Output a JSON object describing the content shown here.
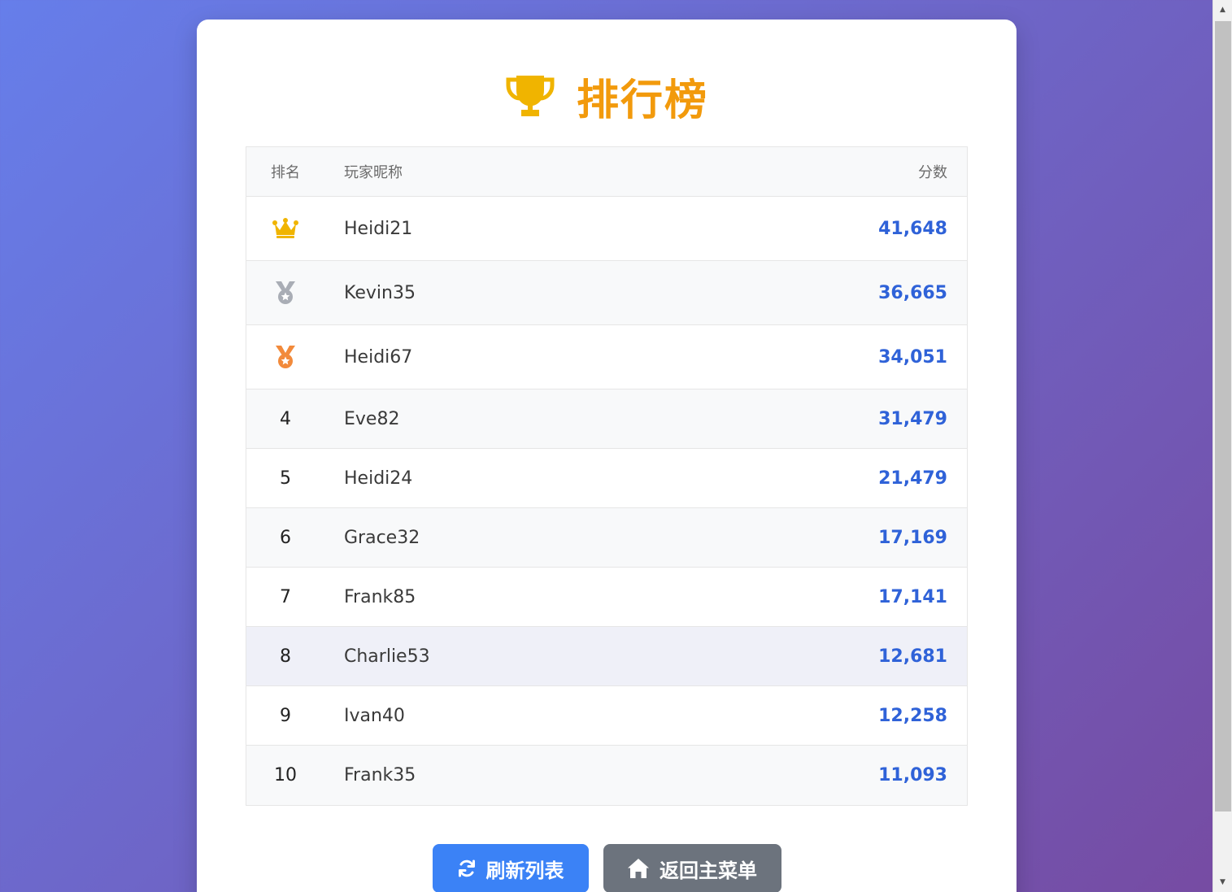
{
  "leaderboard": {
    "title": "排行榜",
    "title_icon": "trophy-icon",
    "colors": {
      "title": "#f29a0c",
      "score": "#2f62d8",
      "gold": "#f0b400",
      "silver": "#a9adb5",
      "bronze": "#f28a3b"
    },
    "headers": {
      "rank": "排名",
      "name": "玩家昵称",
      "score": "分数"
    },
    "rows": [
      {
        "rank": "1",
        "rank_icon": "crown-icon",
        "name": "Heidi21",
        "score": "41,648"
      },
      {
        "rank": "2",
        "rank_icon": "silver-medal-icon",
        "name": "Kevin35",
        "score": "36,665"
      },
      {
        "rank": "3",
        "rank_icon": "bronze-medal-icon",
        "name": "Heidi67",
        "score": "34,051"
      },
      {
        "rank": "4",
        "name": "Eve82",
        "score": "31,479"
      },
      {
        "rank": "5",
        "name": "Heidi24",
        "score": "21,479"
      },
      {
        "rank": "6",
        "name": "Grace32",
        "score": "17,169"
      },
      {
        "rank": "7",
        "name": "Frank85",
        "score": "17,141"
      },
      {
        "rank": "8",
        "name": "Charlie53",
        "score": "12,681"
      },
      {
        "rank": "9",
        "name": "Ivan40",
        "score": "12,258"
      },
      {
        "rank": "10",
        "name": "Frank35",
        "score": "11,093"
      }
    ]
  },
  "actions": {
    "refresh_label": "刷新列表",
    "refresh_icon": "refresh-icon",
    "refresh_color": "#3b82f6",
    "home_label": "返回主菜单",
    "home_icon": "home-icon",
    "home_color": "#6c737d"
  }
}
